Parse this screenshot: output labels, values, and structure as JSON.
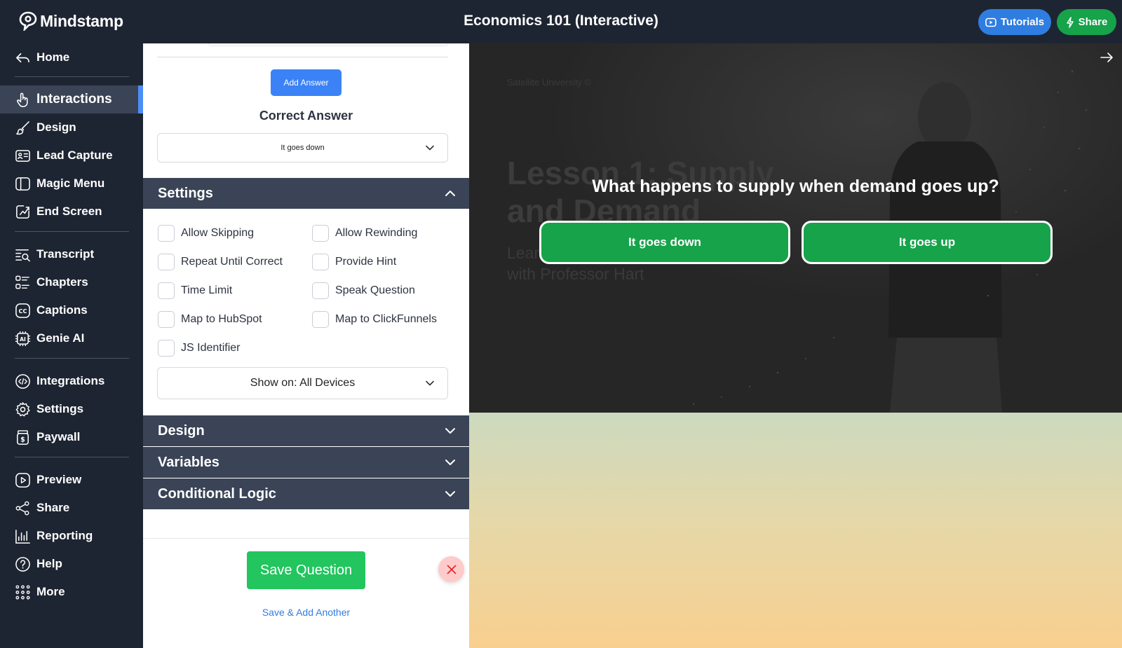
{
  "app": {
    "brand": "Mindstamp",
    "title": "Economics 101 (Interactive)",
    "tutorials_label": "Tutorials",
    "share_label": "Share"
  },
  "sidebar": {
    "items": [
      {
        "label": "Home",
        "icon": "home-icon"
      },
      {
        "label": "Interactions",
        "icon": "pointer-hand-icon",
        "active": true
      },
      {
        "label": "Design",
        "icon": "brush-icon"
      },
      {
        "label": "Lead Capture",
        "icon": "contact-card-icon"
      },
      {
        "label": "Magic Menu",
        "icon": "side-panel-icon"
      },
      {
        "label": "End Screen",
        "icon": "end-screen-icon"
      },
      {
        "label": "Transcript",
        "icon": "transcript-search-icon"
      },
      {
        "label": "Chapters",
        "icon": "chapters-list-icon"
      },
      {
        "label": "Captions",
        "icon": "cc-icon"
      },
      {
        "label": "Genie AI",
        "icon": "ai-chip-icon"
      },
      {
        "label": "Integrations",
        "icon": "code-icon"
      },
      {
        "label": "Settings",
        "icon": "gear-icon"
      },
      {
        "label": "Paywall",
        "icon": "dollar-jar-icon"
      },
      {
        "label": "Preview",
        "icon": "play-icon"
      },
      {
        "label": "Share",
        "icon": "share-nodes-icon"
      },
      {
        "label": "Reporting",
        "icon": "bar-chart-icon"
      },
      {
        "label": "Help",
        "icon": "question-icon"
      },
      {
        "label": "More",
        "icon": "grid-dots-icon"
      }
    ]
  },
  "editor": {
    "add_answer_label": "Add Answer",
    "correct_answer_heading": "Correct Answer",
    "correct_answer_value": "It goes down",
    "settings_heading": "Settings",
    "checkboxes": [
      "Allow Skipping",
      "Allow Rewinding",
      "Repeat Until Correct",
      "Provide Hint",
      "Time Limit",
      "Speak Question",
      "Map to HubSpot",
      "Map to ClickFunnels",
      "JS Identifier"
    ],
    "show_on_value": "Show on: All Devices",
    "sections": [
      "Design",
      "Variables",
      "Conditional Logic"
    ],
    "save_question_label": "Save Question",
    "save_add_another_label": "Save & Add Another"
  },
  "preview": {
    "watermark": "Satellite University ©",
    "lesson_title": "Lesson 1: Supply and Demand",
    "lesson_subtitle": "Learn the basics of economics with Professor Hart",
    "question": "What happens to supply when demand goes up?",
    "answers": [
      "It goes down",
      "It goes up"
    ]
  },
  "colors": {
    "nav_bg": "#1e2532",
    "active_item_bg": "#3a4456",
    "active_indicator": "#4c8ef7",
    "primary_blue": "#3b82f6",
    "success_green": "#22c55e",
    "answer_green": "#16a34a",
    "section_header": "#3a4456"
  }
}
